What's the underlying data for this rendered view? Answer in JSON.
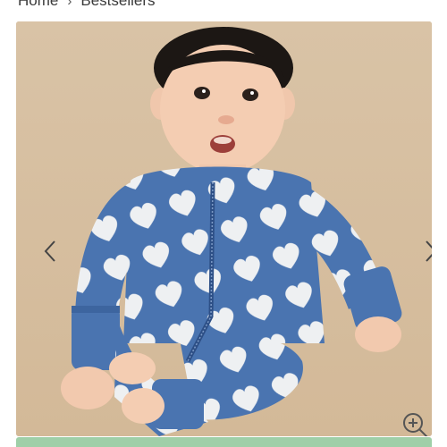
{
  "breadcrumb": {
    "home": "Home",
    "separator": "›",
    "current": "Bestsellers"
  },
  "gallery": {
    "image_alt_icon": "baby-in-blue-heart-print-zip-romper",
    "prev_icon": "chevron-left-icon",
    "next_icon": "chevron-right-icon",
    "zoom_icon": "zoom-in-icon"
  },
  "colors": {
    "photo_background": "#d8c2a5",
    "romper_blue": "#4a74b0",
    "romper_cream": "#eef0f2",
    "bottom_bar": "#9fcfa8"
  }
}
